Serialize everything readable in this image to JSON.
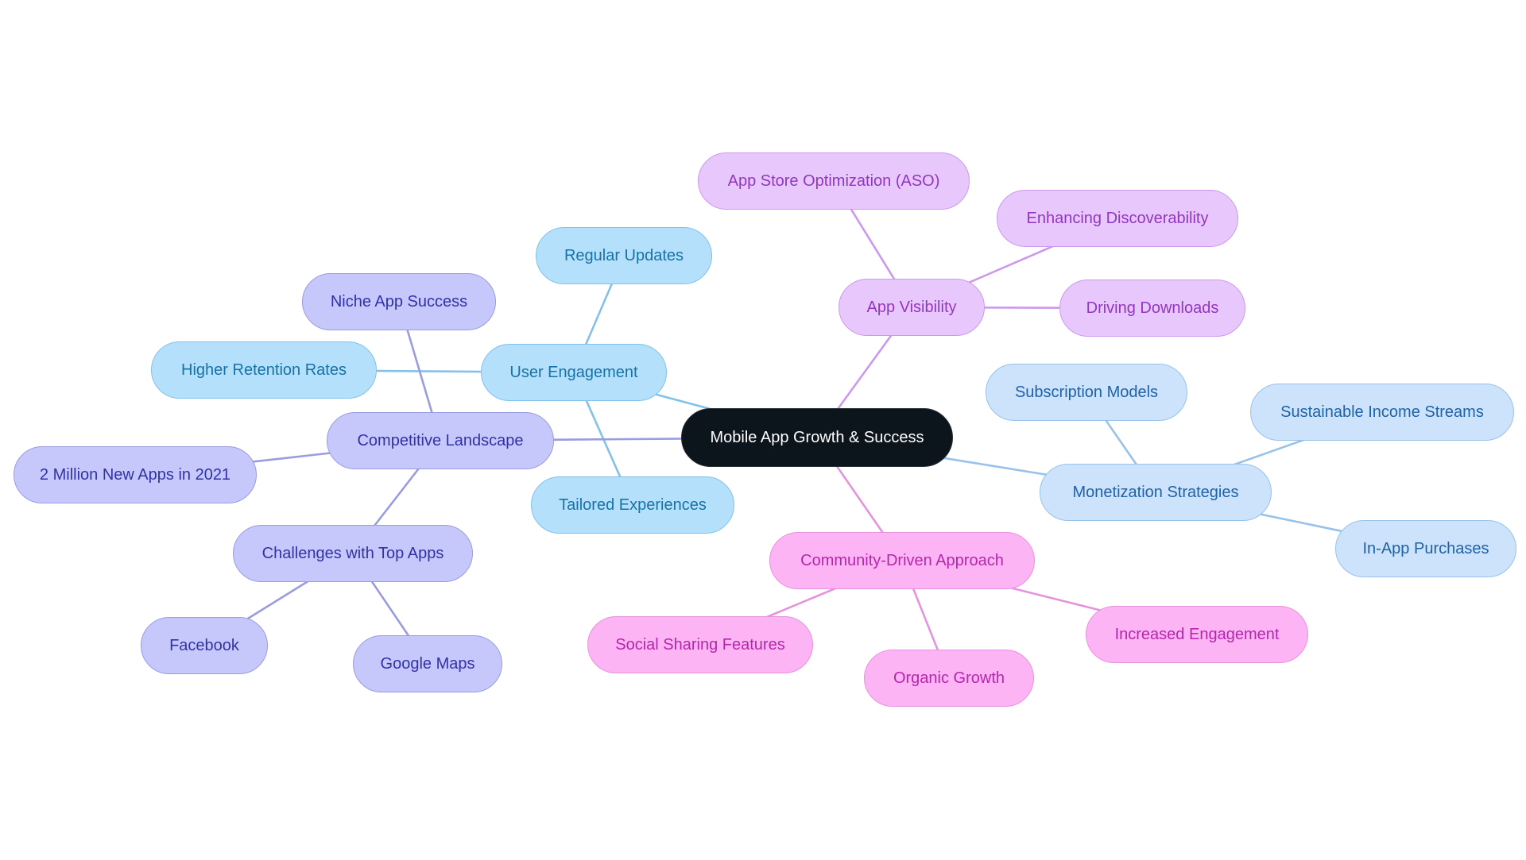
{
  "root": {
    "label": "Mobile App Growth & Success"
  },
  "branches": {
    "user_engagement": {
      "label": "User Engagement",
      "color": "#84c1ea",
      "children": [
        "Regular Updates",
        "Higher Retention Rates",
        "Tailored Experiences"
      ]
    },
    "competitive_landscape": {
      "label": "Competitive Landscape",
      "color": "#9a9ce0",
      "children": [
        "Niche App Success",
        "2 Million New Apps in 2021",
        "Challenges with Top Apps"
      ],
      "sub": {
        "label": "Challenges with Top Apps",
        "children": [
          "Facebook",
          "Google Maps"
        ]
      }
    },
    "app_visibility": {
      "label": "App Visibility",
      "color": "#cc99ee",
      "children": [
        "App Store Optimization (ASO)",
        "Enhancing Discoverability",
        "Driving Downloads"
      ]
    },
    "monetization": {
      "label": "Monetization Strategies",
      "color": "#99c2ea",
      "children": [
        "Subscription Models",
        "Sustainable Income Streams",
        "In-App Purchases"
      ]
    },
    "community": {
      "label": "Community-Driven Approach",
      "color": "#e693de",
      "children": [
        "Social Sharing Features",
        "Organic Growth",
        "Increased Engagement"
      ]
    }
  }
}
